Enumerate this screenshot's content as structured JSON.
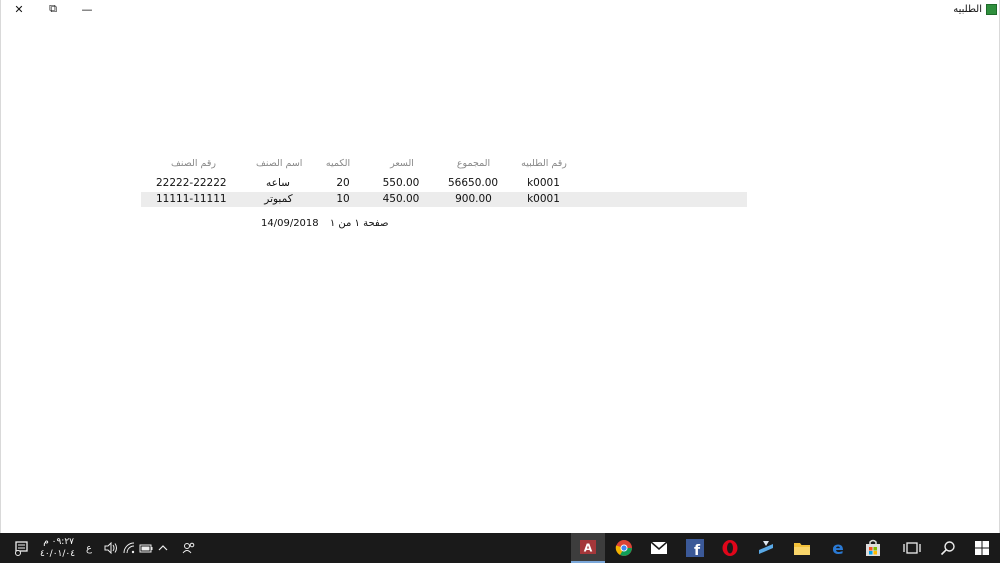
{
  "window": {
    "title": "الطلبيه",
    "controls": {
      "close": "✕",
      "restore": "⧉",
      "minimize": "—"
    }
  },
  "report": {
    "headers": {
      "order_no": "رقم الطلبيه",
      "total": "المجموع",
      "price": "السعر",
      "quantity": "الكميه",
      "item_name": "اسم الصنف",
      "item_no": "رقم الصنف"
    },
    "rows": [
      {
        "order_no": "k0001",
        "total": "56650.00",
        "price": "550.00",
        "quantity": "20",
        "item_name": "ساعه",
        "item_no": "22222-22222"
      },
      {
        "order_no": "k0001",
        "total": "900.00",
        "price": "450.00",
        "quantity": "10",
        "item_name": "كمبوتر",
        "item_no": "11111-11111"
      }
    ],
    "footer": {
      "date": "14/09/2018",
      "page": "صفحة ١ من ١"
    }
  },
  "taskbar": {
    "clock_time": "٠٩:٢٧ م",
    "clock_date": "٤٠/٠١/٠٤",
    "language": "ع",
    "apps": [
      {
        "name": "access-icon"
      },
      {
        "name": "chrome-icon"
      },
      {
        "name": "mail-icon"
      },
      {
        "name": "facebook-icon"
      },
      {
        "name": "opera-icon"
      },
      {
        "name": "download-icon"
      },
      {
        "name": "file-explorer-icon"
      },
      {
        "name": "edge-icon"
      },
      {
        "name": "store-icon"
      },
      {
        "name": "task-view-icon"
      },
      {
        "name": "search-icon"
      },
      {
        "name": "start-icon"
      }
    ],
    "accent": "#1a1a1a"
  }
}
